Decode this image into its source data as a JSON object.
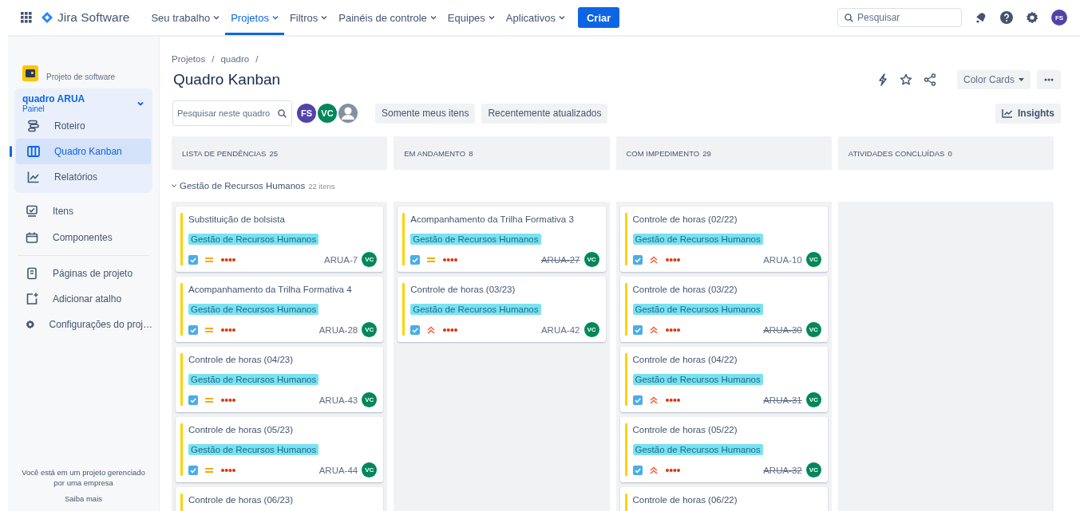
{
  "topnav": {
    "app_name": "Jira Software",
    "items": [
      {
        "label": "Seu trabalho",
        "selected": false
      },
      {
        "label": "Projetos",
        "selected": true
      },
      {
        "label": "Filtros",
        "selected": false
      },
      {
        "label": "Painéis de controle",
        "selected": false
      },
      {
        "label": "Equipes",
        "selected": false
      },
      {
        "label": "Aplicativos",
        "selected": false
      }
    ],
    "create_button": "Criar",
    "search": {
      "placeholder": "Pesquisar"
    },
    "avatar": "FS"
  },
  "sidebar": {
    "project_type": "Projeto de software",
    "board": {
      "name": "quadro ARUA",
      "subtitle": "Painel",
      "expanded": true,
      "items": [
        {
          "label": "Roteiro",
          "selected": false
        },
        {
          "label": "Quadro Kanban",
          "selected": true
        },
        {
          "label": "Relatórios",
          "selected": false
        }
      ]
    },
    "items": [
      {
        "label": "Itens",
        "selected": false
      },
      {
        "label": "Componentes",
        "selected": false
      }
    ],
    "items_2": [
      {
        "label": "Páginas de projeto",
        "selected": false
      },
      {
        "label": "Adicionar atalho",
        "selected": false
      },
      {
        "label": "Configurações do proj…",
        "selected": false
      }
    ],
    "footer": "Você está em um projeto gerenciado por uma empresa",
    "footer_link": "Saiba mais"
  },
  "breadcrumbs": [
    {
      "label": "Projetos",
      "separator": "/"
    },
    {
      "label": "quadro",
      "separator": "/"
    }
  ],
  "title": "Quadro Kanban",
  "header_buttons": {
    "color_cards": "Color Cards"
  },
  "toolbar": {
    "search": {
      "placeholder": "Pesquisar neste quadro"
    },
    "avatars": [
      {
        "initials": "FS",
        "color": "#5243aa"
      },
      {
        "initials": "VC",
        "color": "#00875a"
      },
      {
        "kind": "generic"
      }
    ],
    "filters": [
      "Somente meus itens",
      "Recentemente atualizados"
    ],
    "insights": "Insights"
  },
  "columns": [
    {
      "title": "LISTA DE PENDÊNCIAS",
      "count": "25"
    },
    {
      "title": "EM ANDAMENTO",
      "count": "8"
    },
    {
      "title": "COM IMPEDIMENTO",
      "count": "29"
    },
    {
      "title": "ATIVIDADES CONCLUÍDAS",
      "count": "0"
    }
  ],
  "swimlane": {
    "name": "Gestão de Recursos Humanos",
    "count": "22 itens",
    "expanded": true,
    "cells": [
      [
        {
          "title": "Substituição de bolsista",
          "label": "Gestão de Recursos Humanos",
          "kind": "medium",
          "key": "ARUA-7",
          "done": false,
          "assignee": "VC"
        },
        {
          "title": "Acompanhamento da Trilha Formativa 4",
          "label": "Gestão de Recursos Humanos",
          "kind": "medium",
          "key": "ARUA-28",
          "done": false,
          "assignee": "VC"
        },
        {
          "title": "Controle de horas (04/23)",
          "label": "Gestão de Recursos Humanos",
          "kind": "medium",
          "key": "ARUA-43",
          "done": false,
          "assignee": "VC"
        },
        {
          "title": "Controle de horas (05/23)",
          "label": "Gestão de Recursos Humanos",
          "kind": "medium",
          "key": "ARUA-44",
          "done": false,
          "assignee": "VC"
        },
        {
          "title": "Controle de horas (06/23)"
        }
      ],
      [
        {
          "title": "Acompanhamento da Trilha Formativa 3",
          "label": "Gestão de Recursos Humanos",
          "kind": "medium",
          "key": "ARUA-27",
          "done": true,
          "assignee": "VC"
        },
        {
          "title": "Controle de horas (03/23)",
          "label": "Gestão de Recursos Humanos",
          "kind": "high",
          "key": "ARUA-42",
          "done": false,
          "assignee": "VC"
        }
      ],
      [
        {
          "title": "Controle de horas (02/22)",
          "label": "Gestão de Recursos Humanos",
          "kind": "high",
          "key": "ARUA-10",
          "done": false,
          "assignee": "VC"
        },
        {
          "title": "Controle de horas (03/22)",
          "label": "Gestão de Recursos Humanos",
          "kind": "high",
          "key": "ARUA-30",
          "done": true,
          "assignee": "VC"
        },
        {
          "title": "Controle de horas (04/22)",
          "label": "Gestão de Recursos Humanos",
          "kind": "high",
          "key": "ARUA-31",
          "done": true,
          "assignee": "VC"
        },
        {
          "title": "Controle de horas (05/22)",
          "label": "Gestão de Recursos Humanos",
          "kind": "high",
          "key": "ARUA-32",
          "done": true,
          "assignee": "VC"
        },
        {
          "title": "Controle de horas (06/22)"
        }
      ],
      []
    ]
  }
}
